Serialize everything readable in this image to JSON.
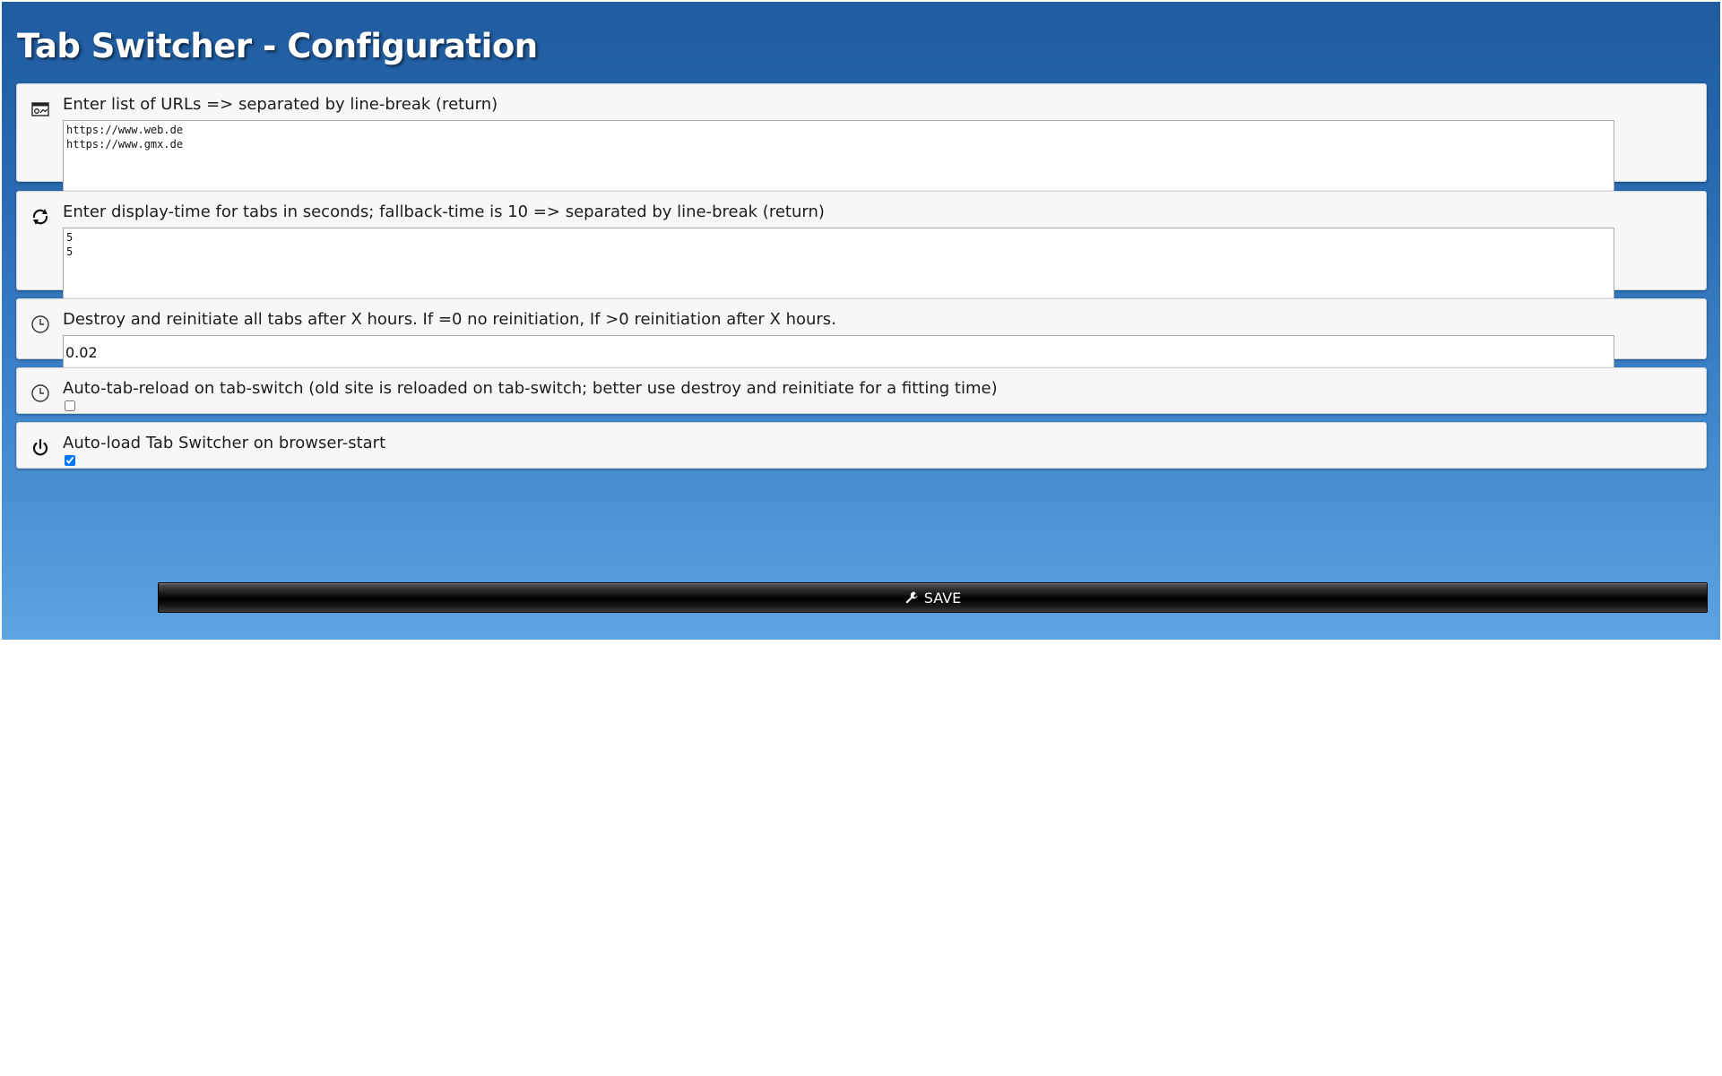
{
  "page": {
    "title": "Tab Switcher - Configuration"
  },
  "sections": {
    "urls": {
      "label": "Enter list of URLs => separated by line-break (return)",
      "value": "https://www.web.de\nhttps://www.gmx.de",
      "icon": "browser-window-icon"
    },
    "display_time": {
      "label": "Enter display-time for tabs in seconds; fallback-time is 10 => separated by line-break (return)",
      "value": "5\n5",
      "icon": "refresh-icon"
    },
    "reinitiate": {
      "label": "Destroy and reinitiate all tabs after X hours. If =0 no reinitiation, If >0 reinitiation after X hours.",
      "value": "0.02",
      "icon": "clock-icon"
    },
    "auto_reload": {
      "label": "Auto-tab-reload on tab-switch (old site is reloaded on tab-switch; better use destroy and reinitiate for a fitting time)",
      "checked": false,
      "icon": "clock-icon"
    },
    "auto_load": {
      "label": "Auto-load Tab Switcher on browser-start",
      "checked": true,
      "icon": "power-icon"
    }
  },
  "save_button": {
    "label": "SAVE",
    "icon": "wrench-icon"
  },
  "colors": {
    "header_top": "#1f5b9f",
    "header_bottom": "#5ea4e0",
    "panel_bg": "#f7f7f7",
    "button_bg": "#000000"
  }
}
